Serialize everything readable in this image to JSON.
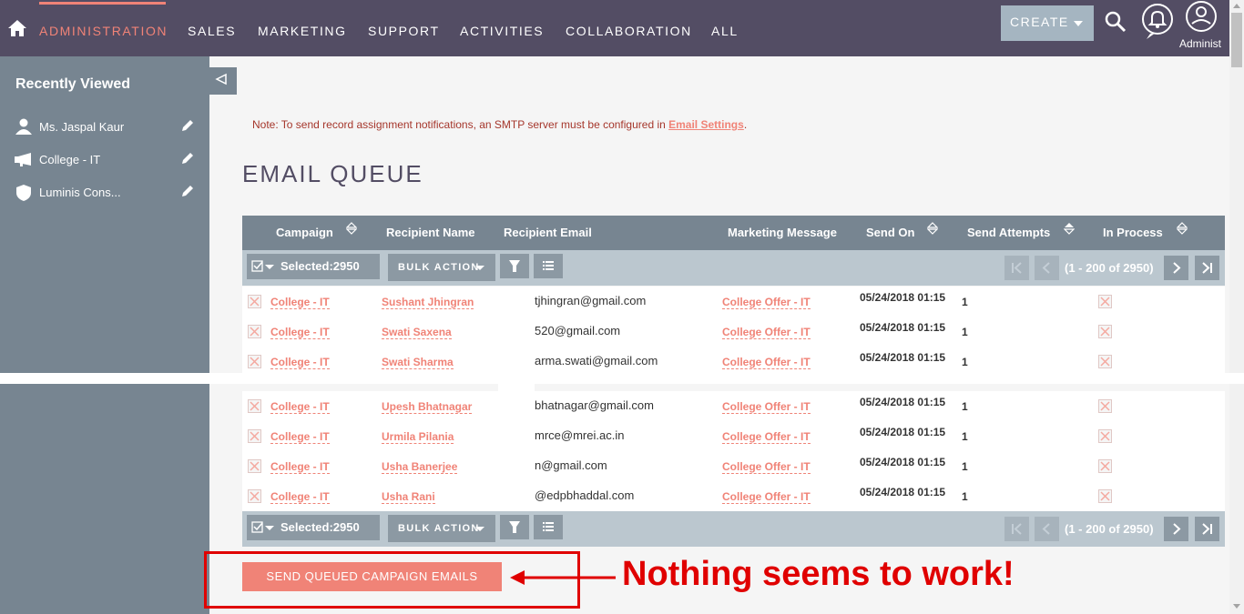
{
  "nav": {
    "items": [
      "ADMINISTRATION",
      "SALES",
      "MARKETING",
      "SUPPORT",
      "ACTIVITIES",
      "COLLABORATION",
      "ALL"
    ],
    "create_label": "CREATE",
    "user_label": "Administ",
    "accent_color": "#f08377",
    "bg_color": "#534d64"
  },
  "sidebar": {
    "title": "Recently Viewed",
    "items": [
      {
        "label": "Ms. Jaspal Kaur",
        "icon": "person-icon"
      },
      {
        "label": "College - IT",
        "icon": "megaphone-icon"
      },
      {
        "label": "Luminis Cons...",
        "icon": "shield-icon"
      }
    ]
  },
  "main": {
    "note_prefix": "Note: To send record assignment notifications, an SMTP server must be configured in ",
    "note_link": "Email Settings",
    "note_suffix": ".",
    "title": "EMAIL QUEUE",
    "columns": [
      "Campaign",
      "Recipient Name",
      "Recipient Email",
      "Marketing Message",
      "Send On",
      "Send Attempts",
      "In Process"
    ],
    "selected_label": "Selected:2950",
    "bulk_action_label": "BULK ACTION",
    "pagination": "(1 - 200 of 2950)",
    "rows": [
      {
        "campaign": "College - IT",
        "recipient": "Sushant Jhingran",
        "email": "tjhingran@gmail.com",
        "message": "College Offer - IT",
        "send_on": "05/24/2018 01:15",
        "attempts": "1"
      },
      {
        "campaign": "College - IT",
        "recipient": "Swati Saxena",
        "email": "520@gmail.com",
        "message": "College Offer - IT",
        "send_on": "05/24/2018 01:15",
        "attempts": "1"
      },
      {
        "campaign": "College - IT",
        "recipient": "Swati Sharma",
        "email": "arma.swati@gmail.com",
        "message": "College Offer - IT",
        "send_on": "05/24/2018 01:15",
        "attempts": "1"
      },
      {
        "campaign": "College - IT",
        "recipient": "Upesh Bhatnagar",
        "email": "bhatnagar@gmail.com",
        "message": "College Offer - IT",
        "send_on": "05/24/2018 01:15",
        "attempts": "1"
      },
      {
        "campaign": "College - IT",
        "recipient": "Urmila Pilania",
        "email": "mrce@mrei.ac.in",
        "message": "College Offer - IT",
        "send_on": "05/24/2018 01:15",
        "attempts": "1"
      },
      {
        "campaign": "College - IT",
        "recipient": "Usha Banerjee",
        "email": "n@gmail.com",
        "message": "College Offer - IT",
        "send_on": "05/24/2018 01:15",
        "attempts": "1"
      },
      {
        "campaign": "College - IT",
        "recipient": "Usha Rani",
        "email": "@edpbhaddal.com",
        "message": "College Offer - IT",
        "send_on": "05/24/2018 01:15",
        "attempts": "1"
      }
    ],
    "send_button": "SEND QUEUED CAMPAIGN EMAILS"
  },
  "annotation": {
    "text": "Nothing seems to work!",
    "color": "#e00000"
  }
}
